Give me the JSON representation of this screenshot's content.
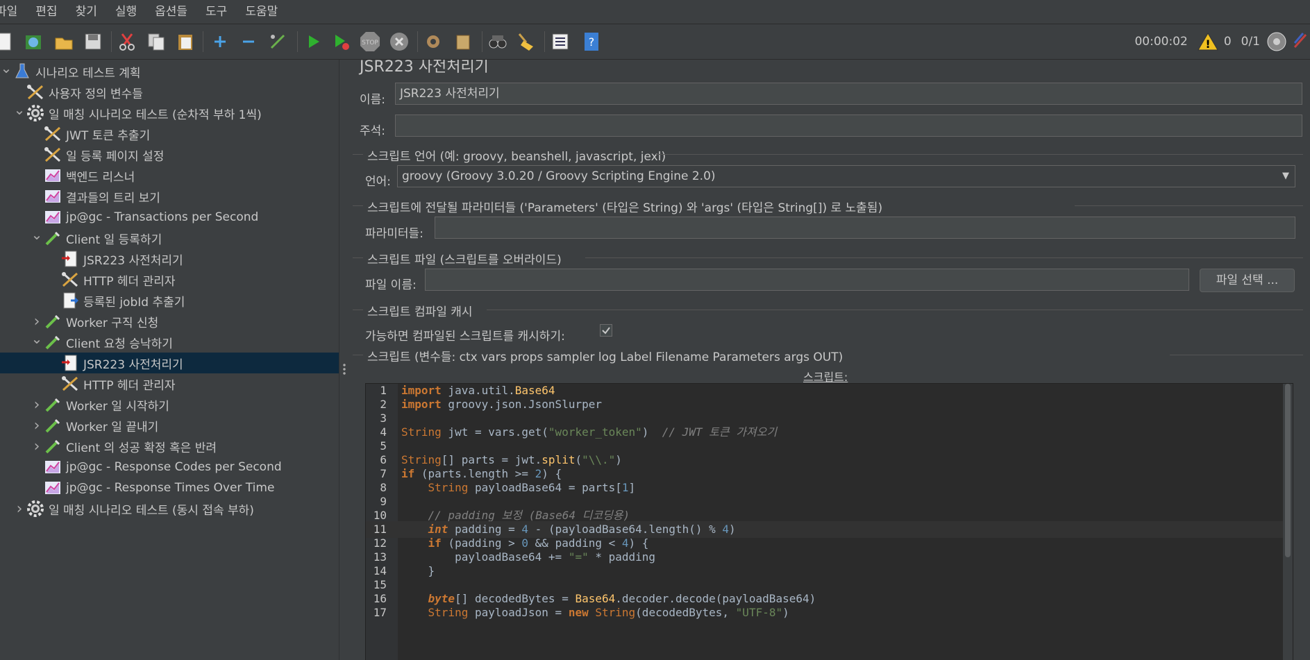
{
  "menu": [
    "파일",
    "편집",
    "찾기",
    "실행",
    "옵션들",
    "도구",
    "도움말"
  ],
  "toolbar": {
    "elapsed": "00:00:02",
    "warning_count": "0",
    "threads": "0/1"
  },
  "tree": [
    {
      "label": "시나리오 테스트 계획",
      "icon": "flask-icon",
      "depth": 0,
      "arrow": "down"
    },
    {
      "label": "사용자 정의 변수들",
      "icon": "tools-icon",
      "depth": 1,
      "arrow": ""
    },
    {
      "label": "일 매칭 시나리오 테스트 (순차적 부하 1씩)",
      "icon": "gear-icon",
      "depth": 1,
      "arrow": "down"
    },
    {
      "label": "JWT 토큰 추출기",
      "icon": "tools-icon",
      "depth": 2,
      "arrow": ""
    },
    {
      "label": "일 등록 페이지 설정",
      "icon": "tools-icon",
      "depth": 2,
      "arrow": ""
    },
    {
      "label": "백엔드 리스너",
      "icon": "chart-icon",
      "depth": 2,
      "arrow": ""
    },
    {
      "label": "결과들의 트리 보기",
      "icon": "chart-icon",
      "depth": 2,
      "arrow": ""
    },
    {
      "label": "jp@gc - Transactions per Second",
      "icon": "chart-icon",
      "depth": 2,
      "arrow": ""
    },
    {
      "label": "Client 일 등록하기",
      "icon": "pipette-icon",
      "depth": 2,
      "arrow": "down"
    },
    {
      "label": "JSR223 사전처리기",
      "icon": "script-icon",
      "depth": 3,
      "arrow": ""
    },
    {
      "label": "HTTP 헤더 관리자",
      "icon": "tools-icon",
      "depth": 3,
      "arrow": ""
    },
    {
      "label": "등록된 jobId 추출기",
      "icon": "extractor-icon",
      "depth": 3,
      "arrow": ""
    },
    {
      "label": "Worker 구직 신청",
      "icon": "pipette-icon",
      "depth": 2,
      "arrow": "right"
    },
    {
      "label": "Client 요청 승낙하기",
      "icon": "pipette-icon",
      "depth": 2,
      "arrow": "down"
    },
    {
      "label": "JSR223 사전처리기",
      "icon": "script-icon",
      "depth": 3,
      "arrow": "",
      "selected": true
    },
    {
      "label": "HTTP 헤더 관리자",
      "icon": "tools-icon",
      "depth": 3,
      "arrow": ""
    },
    {
      "label": "Worker 일 시작하기",
      "icon": "pipette-icon",
      "depth": 2,
      "arrow": "right"
    },
    {
      "label": "Worker 일 끝내기",
      "icon": "pipette-icon",
      "depth": 2,
      "arrow": "right"
    },
    {
      "label": "Client 의 성공 확정 혹은 반려",
      "icon": "pipette-icon",
      "depth": 2,
      "arrow": "right"
    },
    {
      "label": "jp@gc - Response Codes per Second",
      "icon": "chart-icon",
      "depth": 2,
      "arrow": ""
    },
    {
      "label": "jp@gc - Response Times Over Time",
      "icon": "chart-icon",
      "depth": 2,
      "arrow": ""
    },
    {
      "label": "일 매칭 시나리오 테스트 (동시 접속 부하)",
      "icon": "gear-icon",
      "depth": 1,
      "arrow": "right"
    }
  ],
  "panel": {
    "title": "JSR223 사전처리기",
    "name_label": "이름:",
    "name_value": "JSR223 사전처리기",
    "comment_label": "주석:",
    "comment_value": "",
    "lang_section": "스크립트 언어 (예: groovy, beanshell, javascript, jexl)",
    "lang_label": "언어:",
    "lang_value": "groovy     (Groovy 3.0.20 / Groovy Scripting Engine 2.0)",
    "params_section": "스크립트에 전달될 파라미터들 ('Parameters' (타입은 String) 와 'args' (타입은 String[]) 로 노출됨)",
    "params_label": "파라미터들:",
    "params_value": "",
    "file_section": "스크립트 파일 (스크립트를 오버라이드)",
    "file_label": "파일 이름:",
    "file_value": "",
    "file_button": "파일 선택 ...",
    "cache_section": "스크립트 컴파일 캐시",
    "cache_label": "가능하면 컴파일된 스크립트를 캐시하기:",
    "cache_checked": true,
    "script_section": "스크립트 (변수들: ctx vars props sampler log Label Filename Parameters args OUT)",
    "script_label": "스크립트:"
  },
  "code_lines": [
    "1",
    "2",
    "3",
    "4",
    "5",
    "6",
    "7",
    "8",
    "9",
    "10",
    "11",
    "12",
    "13",
    "14",
    "15",
    "16",
    "17"
  ],
  "code": {
    "l1": [
      "import",
      " java.util.",
      "Base64"
    ],
    "l2": [
      "import",
      " groovy.json.JsonSlurper"
    ],
    "l4": [
      "String",
      " jwt = vars.get(",
      "\"worker_token\"",
      ")  ",
      "// JWT 토큰 가져오기"
    ],
    "l6": [
      "String",
      "[] parts = jwt.",
      "split",
      "(",
      "\"\\\\.\"",
      ")"
    ],
    "l7": [
      "if",
      " (parts.length >= ",
      "2",
      ") {"
    ],
    "l8": [
      "    ",
      "String",
      " payloadBase64 = parts[",
      "1",
      "]"
    ],
    "l10": [
      "    ",
      "// padding 보정 (Base64 디코딩용)"
    ],
    "l11": [
      "    ",
      "int",
      " padding = ",
      "4",
      " - (payloadBase64.length() % ",
      "4",
      ")"
    ],
    "l12": [
      "    ",
      "if",
      " (padding > ",
      "0",
      " && padding < ",
      "4",
      ") {"
    ],
    "l13": [
      "        payloadBase64 += ",
      "\"=\"",
      " * padding"
    ],
    "l14": [
      "    }"
    ],
    "l16": [
      "    ",
      "byte",
      "[] decodedBytes = ",
      "Base64",
      ".decoder.decode(payloadBase64)"
    ],
    "l17": [
      "    ",
      "String",
      " payloadJson = ",
      "new",
      " ",
      "String",
      "(decodedBytes, ",
      "\"UTF-8\"",
      ")"
    ]
  }
}
